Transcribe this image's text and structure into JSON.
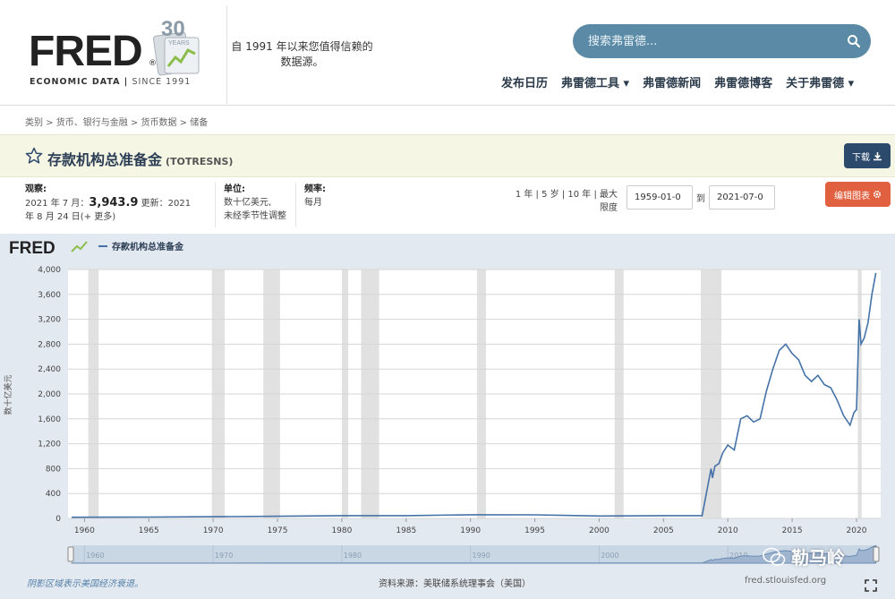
{
  "header": {
    "logo_text": "FRED",
    "logo_sub_a": "ECONOMIC DATA",
    "logo_sub_b": "SINCE 1991",
    "badge_number": "30",
    "badge_word": "YEARS",
    "tagline": "自 1991 年以来您值得信赖的数据源。",
    "search_placeholder": "搜索弗雷德...",
    "nav": [
      "发布日历",
      "弗雷德工具 ▾",
      "弗雷德新闻",
      "弗雷德博客",
      "关于弗雷德 ▾"
    ]
  },
  "breadcrumb": "类别 > 货币、银行与金融 > 货币数据 > 储备",
  "series": {
    "title": "存款机构总准备金",
    "code": "(TOTRESNS)",
    "download_label": "下载"
  },
  "info": {
    "obs_label": "观察:",
    "obs_line1_prefix": "2021 年 7 月：",
    "obs_value": "3,943.9",
    "obs_line1_suffix": "更新：2021",
    "obs_line2": "年 8 月 24 日(+ 更多)",
    "units_label": "单位:",
    "units_line1": "数十亿美元,",
    "units_line2": "未经季节性调整",
    "freq_label": "频率:",
    "freq_value": "每月",
    "range_line1": "1 年 | 5 岁 | 10 年 | 最大",
    "range_line2": "限度",
    "date_start": "1959-01-0",
    "date_to": "到",
    "date_end": "2021-07-0",
    "edit_label": "编辑图表"
  },
  "chart_data": {
    "type": "line",
    "legend_logo": "FRED",
    "legend": "存款机构总准备金",
    "ylabel": "数十亿美元",
    "ylim": [
      0,
      4000
    ],
    "y_ticks": [
      0,
      400,
      800,
      1200,
      1600,
      2000,
      2400,
      2800,
      3200,
      3600,
      4000
    ],
    "y_tick_labels": [
      "0",
      "400",
      "800",
      "1,200",
      "1,600",
      "2,000",
      "2,400",
      "2,800",
      "3,200",
      "3,600",
      "4,000"
    ],
    "xlim": [
      1959.0,
      2021.6
    ],
    "x_ticks": [
      1960,
      1965,
      1970,
      1975,
      1980,
      1985,
      1990,
      1995,
      2000,
      2005,
      2010,
      2015,
      2020
    ],
    "navigator_ticks": [
      1960,
      1970,
      1980,
      1990,
      2000,
      2010
    ],
    "line_color": "#4572a7",
    "recessions": [
      [
        1960.3,
        1961.1
      ],
      [
        1969.9,
        1970.9
      ],
      [
        1973.9,
        1975.2
      ],
      [
        1980.0,
        1980.5
      ],
      [
        1981.5,
        1982.9
      ],
      [
        1990.5,
        1991.2
      ],
      [
        2001.2,
        2001.9
      ],
      [
        2007.9,
        2009.5
      ],
      [
        2020.1,
        2020.4
      ]
    ],
    "x": [
      1959.0,
      1965.0,
      1970.0,
      1975.0,
      1980.0,
      1985.0,
      1990.0,
      1995.0,
      2000.0,
      2005.0,
      2008.0,
      2008.7,
      2008.8,
      2009.0,
      2009.3,
      2009.6,
      2010.0,
      2010.5,
      2011.0,
      2011.5,
      2012.0,
      2012.5,
      2013.0,
      2013.5,
      2014.0,
      2014.5,
      2015.0,
      2015.5,
      2016.0,
      2016.5,
      2017.0,
      2017.5,
      2018.0,
      2018.5,
      2019.0,
      2019.5,
      2019.8,
      2020.0,
      2020.2,
      2020.35,
      2020.6,
      2020.9,
      2021.2,
      2021.5
    ],
    "values": [
      19,
      22,
      27,
      35,
      44,
      45,
      59,
      58,
      39,
      45,
      45,
      800,
      650,
      840,
      880,
      1050,
      1180,
      1100,
      1600,
      1650,
      1550,
      1600,
      2050,
      2400,
      2700,
      2800,
      2650,
      2550,
      2300,
      2200,
      2300,
      2150,
      2100,
      1900,
      1650,
      1500,
      1700,
      1750,
      3200,
      2800,
      2900,
      3150,
      3600,
      3944
    ]
  },
  "footer": {
    "recession_note": "阴影区域表示美国经济衰退。",
    "source": "资料来源：美联储系统理事会（美国）",
    "site": "fred.stlouisfed.org",
    "watermark": "勒马岭"
  }
}
